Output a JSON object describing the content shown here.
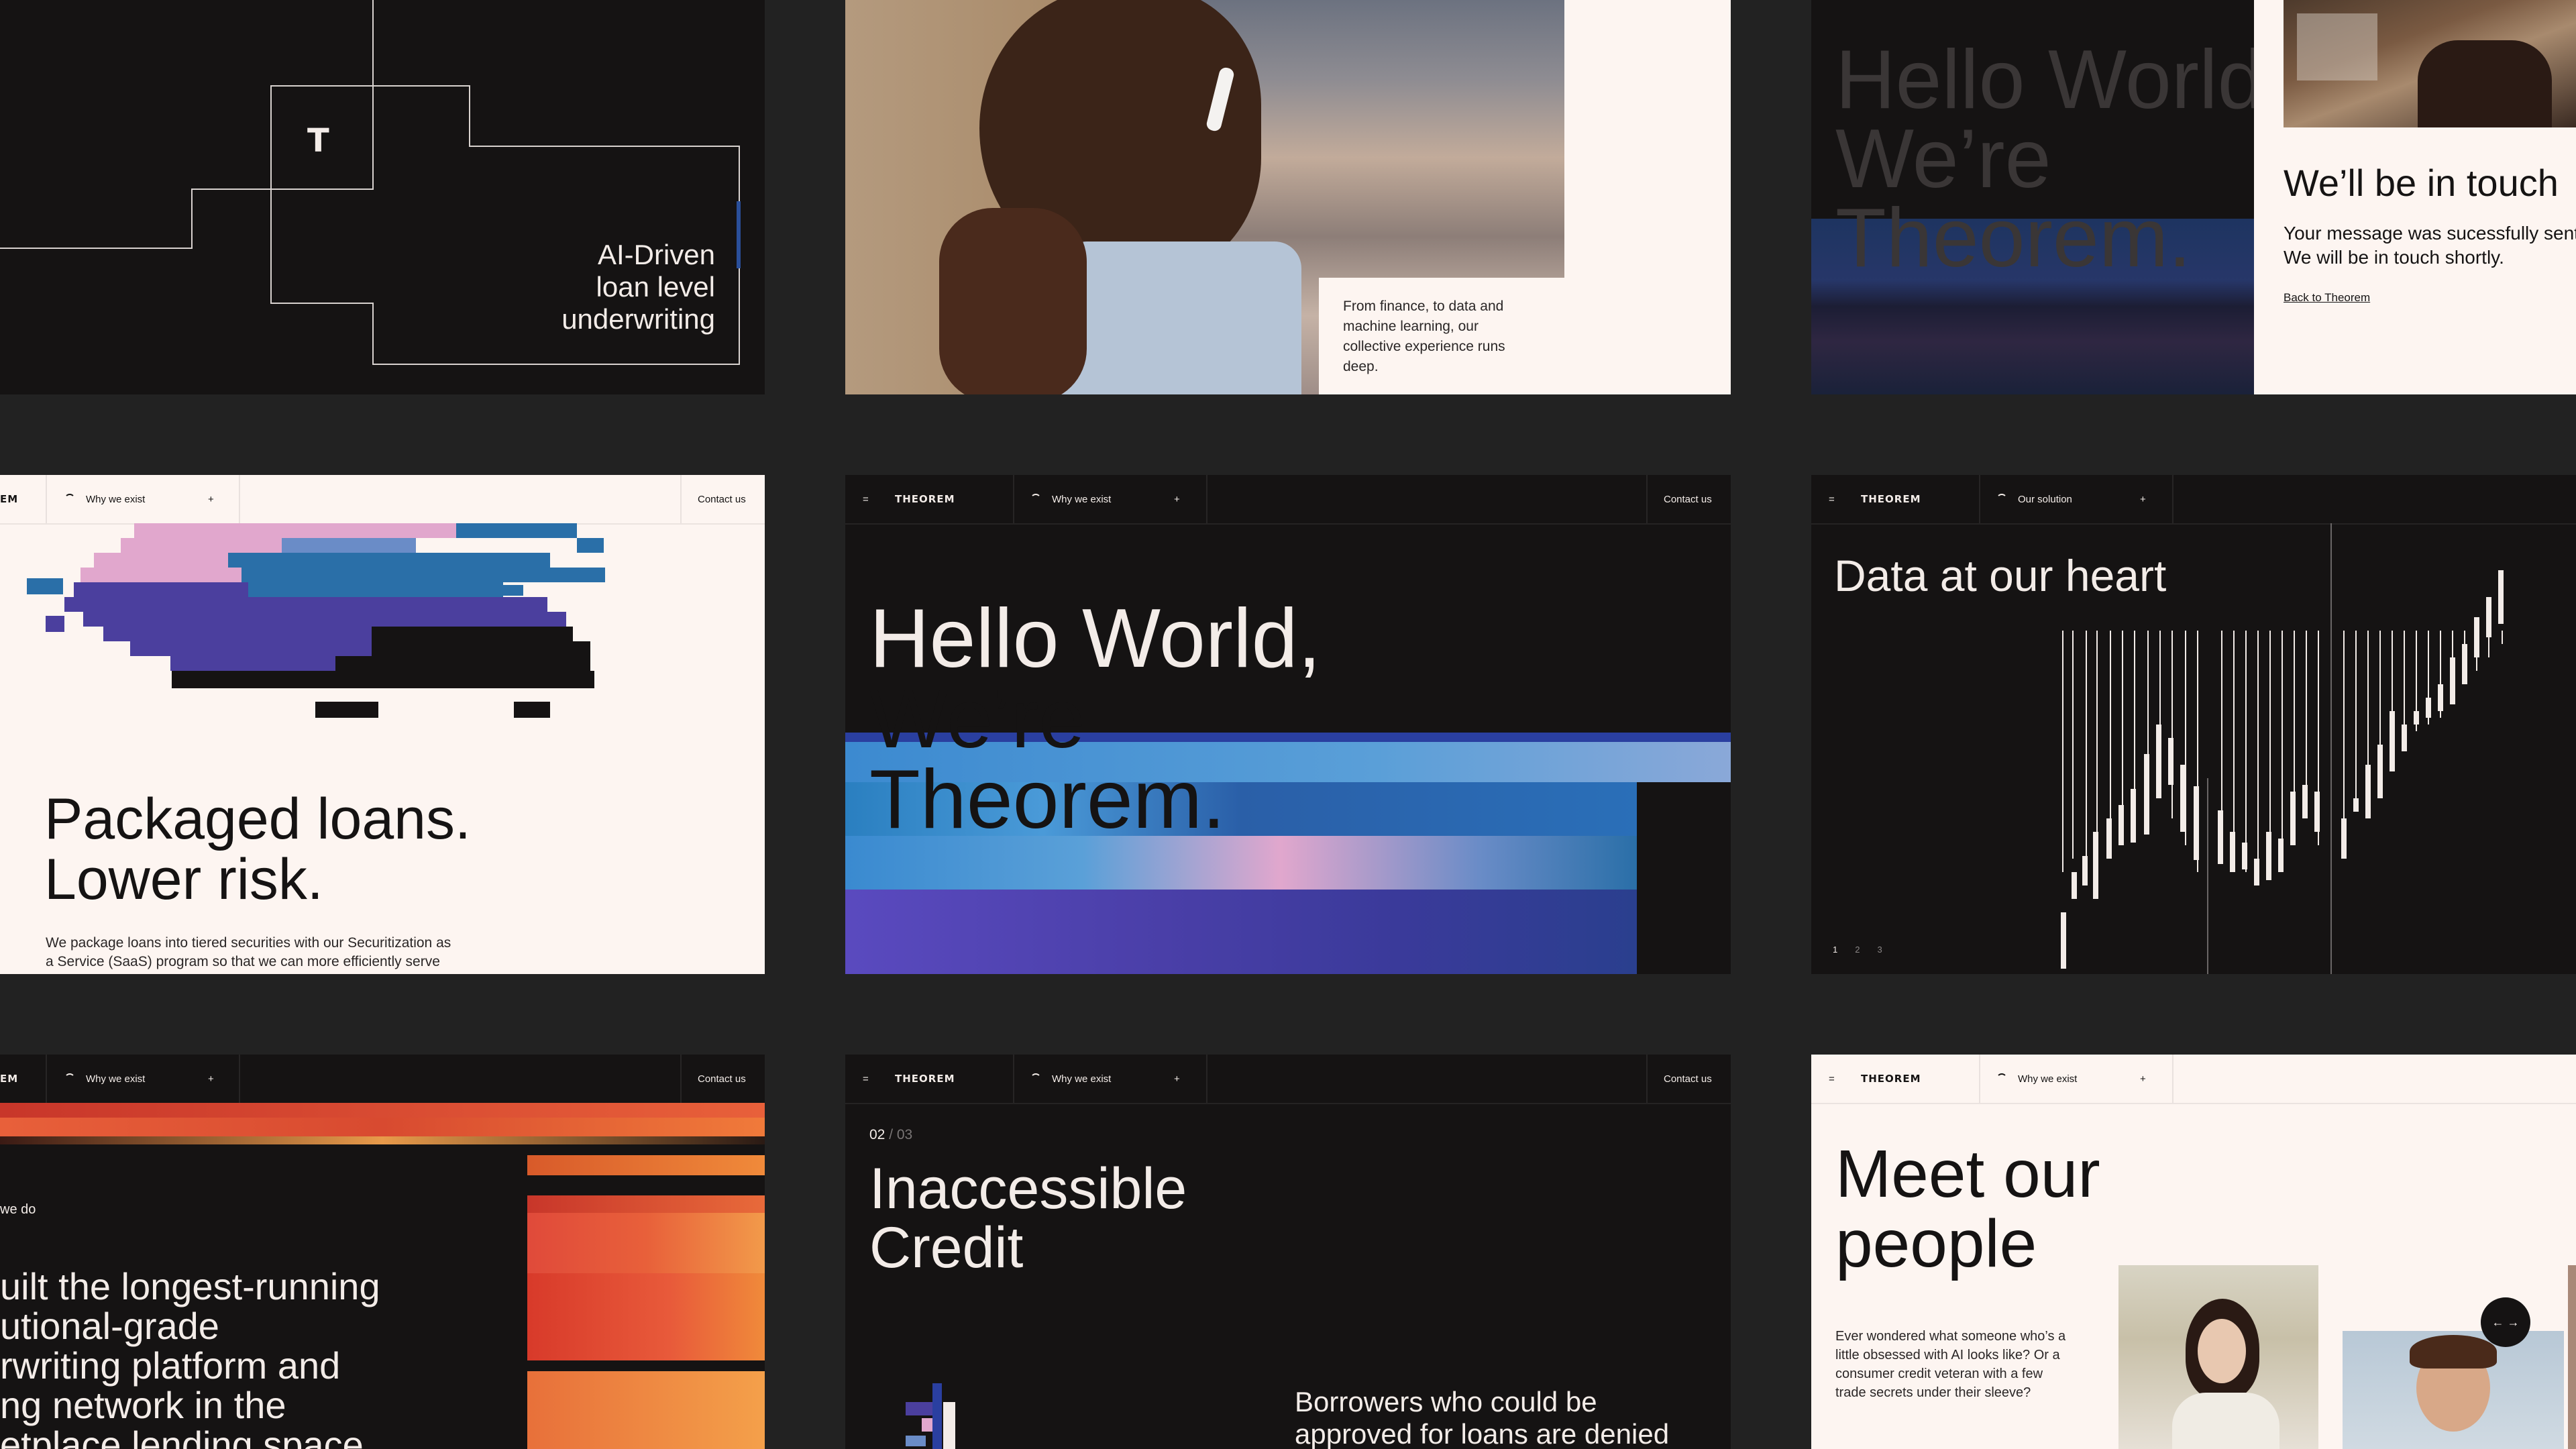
{
  "brand": {
    "logo": "THEOREM",
    "logo_cut": "EM",
    "t_mark": "T"
  },
  "nav": {
    "why": "Why we exist",
    "solution": "Our solution",
    "contact": "Contact us"
  },
  "p1": {
    "l1": "AI-Driven",
    "l2": "loan level",
    "l3": "underwriting"
  },
  "p2": {
    "caption": "From finance, to data and machine learning, our collective experience runs deep."
  },
  "p3": {
    "l1": "Hello World",
    "l2": "We’re",
    "l3": "Theorem."
  },
  "p4": {
    "title": "We’ll be in touch",
    "msg1": "Your message was sucessfully sent.",
    "msg2": "We will be in touch shortly.",
    "link": "Back to Theorem"
  },
  "p5": {
    "h1": "Packaged loans.",
    "h2": "Lower risk.",
    "body1": "We package loans into tiered securities with our Securitization as",
    "body2": "a Service (SaaS) program so that we can more efficiently serve"
  },
  "p6": {
    "l1": "Hello World,",
    "l2": "We’re",
    "l3": "Theorem."
  },
  "p7": {
    "title": "Data at our heart",
    "pages": [
      "1",
      "2",
      "3"
    ]
  },
  "p8": {
    "eyebrow": "we do",
    "l1": "uilt the longest-running",
    "l2": "utional-grade",
    "l3": "rwriting platform and",
    "l4": "ng network in the",
    "l5": "etplace lending space."
  },
  "p9": {
    "counter_cur": "02",
    "counter_sep": " / 03",
    "h1": "Inaccessible",
    "h2": "Credit",
    "body1": "Borrowers who could be",
    "body2": "approved for loans are denied"
  },
  "p10": {
    "h1": "Meet our",
    "h2": "people",
    "body1": "Ever wondered what someone who’s a",
    "body2": "little obsessed with AI looks like? Or a",
    "body3": "consumer credit veteran with a few",
    "body4": "trade secrets under their sleeve?",
    "arrows": "← →"
  },
  "colors": {
    "dark": "#151313",
    "light": "#fdf5f1",
    "blue": "#2a6fa8",
    "violet": "#4b3f9e",
    "pink": "#e1a7cd",
    "orange": "#e8603a"
  }
}
